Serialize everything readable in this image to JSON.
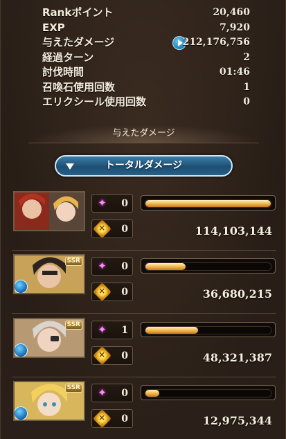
{
  "stats": [
    {
      "label": "Rankポイント",
      "value": "20,460"
    },
    {
      "label": "EXP",
      "value": "7,920"
    },
    {
      "label": "与えたダメージ",
      "value": "212,176,756",
      "icon": "play-icon"
    },
    {
      "label": "経過ターン",
      "value": "2"
    },
    {
      "label": "討伐時間",
      "value": "01:46"
    },
    {
      "label": "召喚石使用回数",
      "value": "1"
    },
    {
      "label": "エリクシール使用回数",
      "value": "0"
    }
  ],
  "section_title": "与えたダメージ",
  "damage_select": {
    "label": "トータルダメージ",
    "icon": "triangle-down-icon"
  },
  "characters": [
    {
      "portrait": "character-portrait",
      "skill_count": "0",
      "ougi_count": "0",
      "damage": "114,103,144",
      "share": 1.0,
      "ssr": false,
      "element_icon": false
    },
    {
      "portrait": "character-portrait",
      "skill_count": "0",
      "ougi_count": "0",
      "damage": "36,680,215",
      "share": 0.32,
      "ssr": true,
      "element_icon": true
    },
    {
      "portrait": "character-portrait",
      "skill_count": "1",
      "ougi_count": "0",
      "damage": "48,321,387",
      "share": 0.42,
      "ssr": true,
      "element_icon": true
    },
    {
      "portrait": "character-portrait",
      "skill_count": "0",
      "ougi_count": "0",
      "damage": "12,975,344",
      "share": 0.11,
      "ssr": true,
      "element_icon": true
    }
  ],
  "ssr_text": "SSR",
  "colors": {
    "bar_fill": "#f1b955",
    "skill_icon": "#ff8cff",
    "ougi_icon": "#ffe35a",
    "select_button": "#2a6590"
  }
}
